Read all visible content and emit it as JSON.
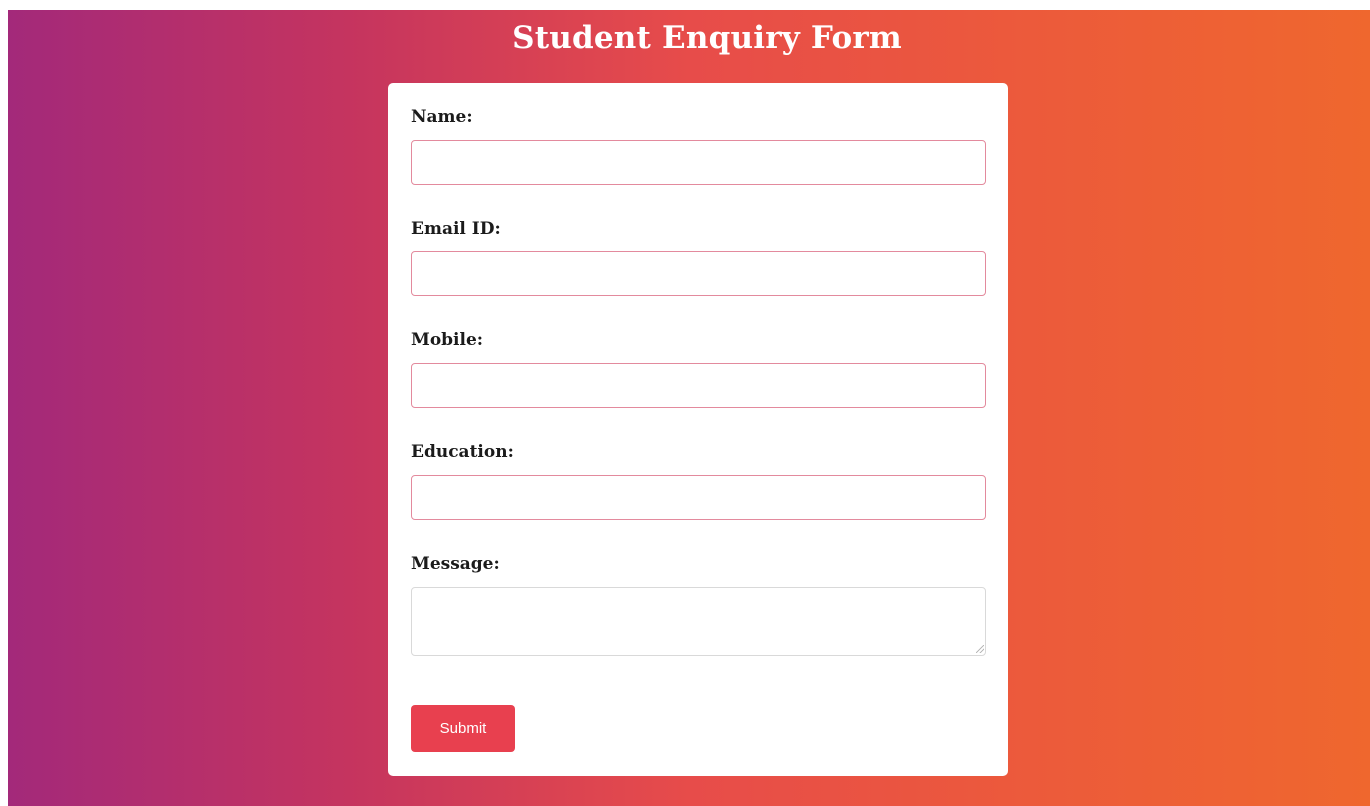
{
  "form": {
    "title": "Student Enquiry Form",
    "fields": {
      "name": {
        "label": "Name:",
        "value": ""
      },
      "email": {
        "label": "Email ID:",
        "value": ""
      },
      "mobile": {
        "label": "Mobile:",
        "value": ""
      },
      "education": {
        "label": "Education:",
        "value": ""
      },
      "message": {
        "label": "Message:",
        "value": ""
      }
    },
    "submit_label": "Submit"
  },
  "colors": {
    "gradient_start": "#a3297a",
    "gradient_end": "#ef672e",
    "button": "#e8404f",
    "input_border": "#e38a9d"
  }
}
